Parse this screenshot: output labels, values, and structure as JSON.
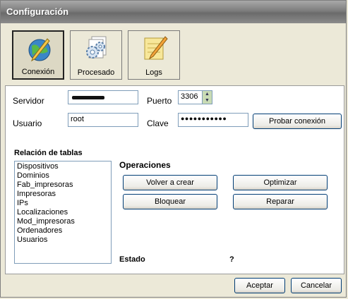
{
  "window": {
    "title": "Configuración"
  },
  "toolbar": [
    {
      "label": "Conexión",
      "icon": "globe-pencil-icon"
    },
    {
      "label": "Procesado",
      "icon": "gears-icon"
    },
    {
      "label": "Logs",
      "icon": "notepad-pencil-icon"
    }
  ],
  "connection": {
    "server_label": "Servidor",
    "server_value": "",
    "port_label": "Puerto",
    "port_value": "3306",
    "user_label": "Usuario",
    "user_value": "root",
    "password_label": "Clave",
    "password_value": "●●●●●●●●●●●",
    "test_button": "Probar conexión"
  },
  "tables": {
    "heading": "Relación de tablas",
    "items": [
      "Dispositivos",
      "Dominios",
      "Fab_impresoras",
      "Impresoras",
      "IPs",
      "Localizaciones",
      "Mod_impresoras",
      "Ordenadores",
      "Usuarios"
    ]
  },
  "operations": {
    "heading": "Operaciones",
    "recreate": "Volver a crear",
    "optimize": "Optimizar",
    "lock": "Bloquear",
    "repair": "Reparar"
  },
  "status": {
    "label": "Estado",
    "value": "?"
  },
  "footer": {
    "accept": "Aceptar",
    "cancel": "Cancelar"
  }
}
